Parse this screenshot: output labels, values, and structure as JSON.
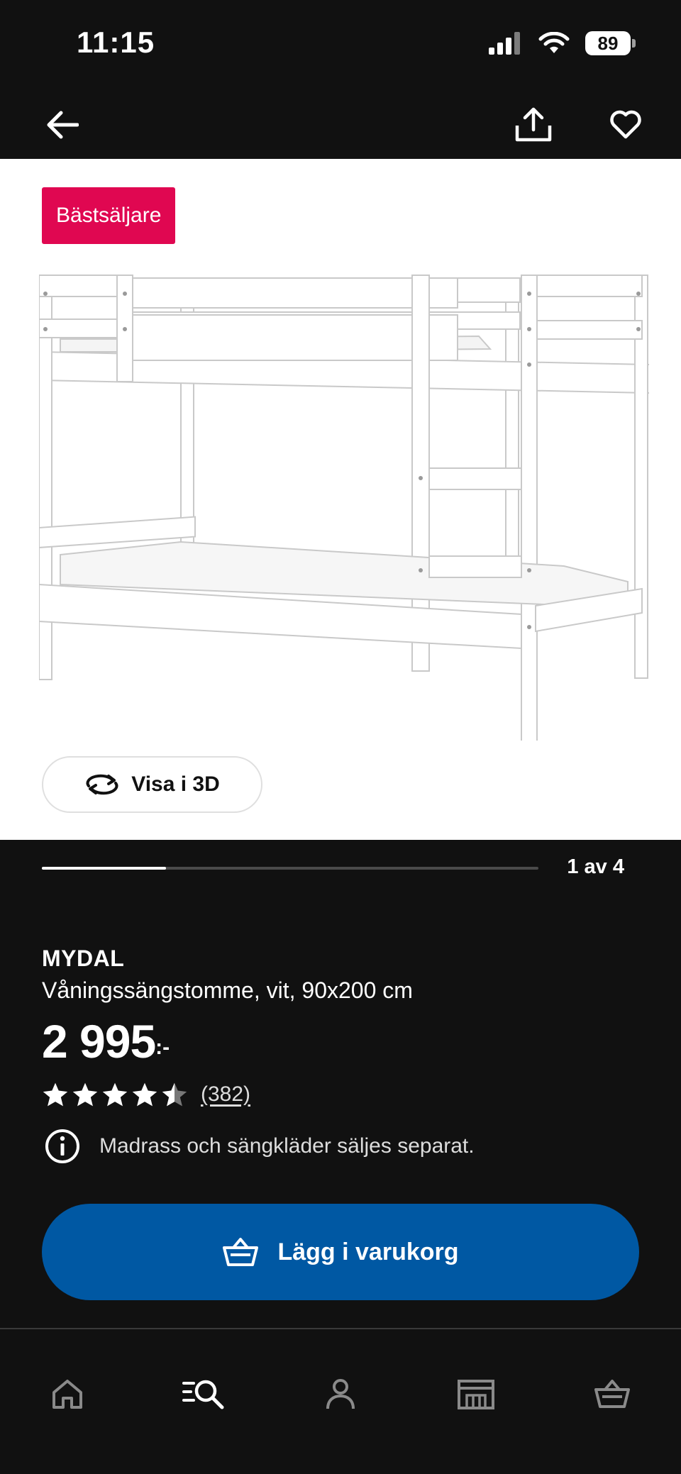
{
  "status_bar": {
    "time": "11:15",
    "battery": "89"
  },
  "top_nav": {
    "back_icon": "back-arrow-icon",
    "share_icon": "share-icon",
    "favorite_icon": "heart-icon"
  },
  "product_image": {
    "badge": "Bästsäljare",
    "view3d_label": "Visa i 3D"
  },
  "carousel": {
    "counter": "1 av 4",
    "progress": 0.25
  },
  "product": {
    "name": "MYDAL",
    "description": "Våningssängstomme, vit, 90x200 cm",
    "price": "2 995",
    "price_suffix": ":-",
    "rating": 4.5,
    "review_count": "(382)",
    "notice": "Madrass och sängkläder säljes separat."
  },
  "cta": {
    "label": "Lägg i varukorg"
  },
  "bottom_nav": {
    "tabs": [
      "home-icon",
      "search-icon",
      "profile-icon",
      "store-icon",
      "cart-icon"
    ]
  },
  "colors": {
    "badge": "#e00751",
    "cta": "#0058a3",
    "background": "#111111"
  }
}
